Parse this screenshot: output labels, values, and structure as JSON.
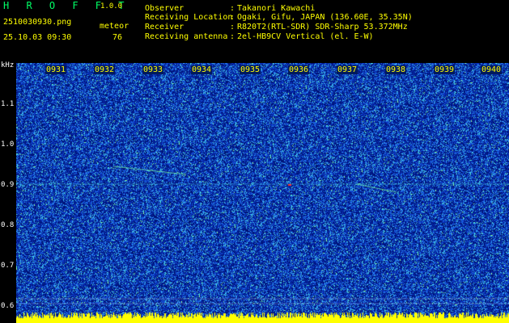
{
  "header": {
    "app_title": "H R O F F T",
    "app_version": "1.0.0",
    "file_name": "2510030930.png",
    "timestamp": "25.10.03 09:30",
    "meteor_label": "meteor",
    "meteor_count": "76"
  },
  "info": [
    {
      "label": "Observer",
      "value": "Takanori Kawachi"
    },
    {
      "label": "Receiving Location",
      "value": "Ogaki, Gifu, JAPAN (136.60E, 35.35N)"
    },
    {
      "label": "Receiver",
      "value": "R820T2(RTL-SDR) SDR-Sharp 53.372MHz"
    },
    {
      "label": "Receiving antenna",
      "value": "2el-HB9CV Vertical (el. E-W)"
    }
  ],
  "y_axis": {
    "unit": "kHz",
    "ticks": [
      "1.1",
      "1.0",
      "0.9",
      "0.8",
      "0.7",
      "0.6"
    ]
  },
  "x_axis": {
    "ticks": [
      "0931",
      "0932",
      "0933",
      "0934",
      "0935",
      "0936",
      "0937",
      "0938",
      "0939",
      "0940"
    ]
  },
  "colors": {
    "background": "#000000",
    "spectrogram_base": "#0a2a9a",
    "text": "#ffff00",
    "title": "#00ff66",
    "level_bar": "#ffff00"
  }
}
